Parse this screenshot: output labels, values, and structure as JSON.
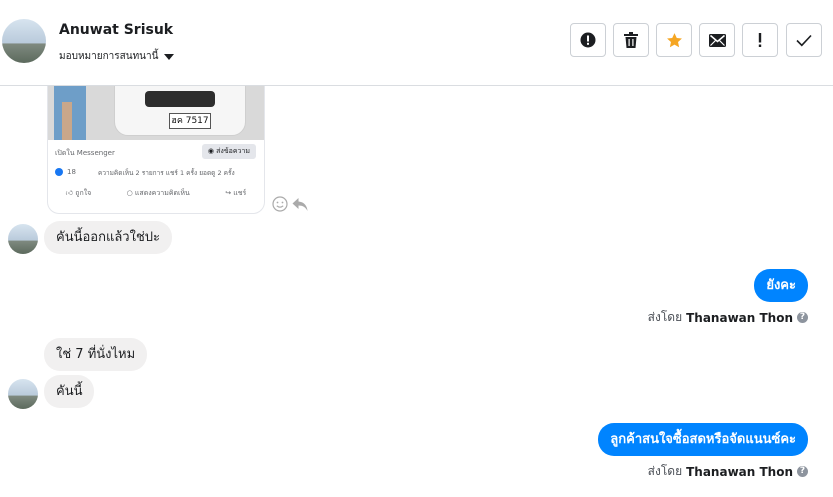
{
  "header": {
    "name": "Anuwat Srisuk",
    "assign_label": "มอบหมายการสนทนานี้",
    "actions": [
      {
        "name": "report-button",
        "icon": "alert-circle-icon"
      },
      {
        "name": "delete-button",
        "icon": "trash-icon"
      },
      {
        "name": "star-button",
        "icon": "star-icon",
        "color": "#f5a623"
      },
      {
        "name": "mark-unread-button",
        "icon": "envelope-icon"
      },
      {
        "name": "important-button",
        "icon": "exclamation-icon"
      },
      {
        "name": "done-button",
        "icon": "check-icon"
      }
    ]
  },
  "shared_post": {
    "plate_text": "ฮค 7517",
    "source_label": "เปิดใน Messenger",
    "send_button": "ส่งข้อความ",
    "like_count": "18",
    "stats": "ความคิดเห็น 2 รายการ  แชร์ 1 ครั้ง  ยอดดู 2 ครั้ง",
    "actions": [
      "ถูกใจ",
      "แสดงความคิดเห็น",
      "แชร์"
    ]
  },
  "messages": [
    {
      "side": "in",
      "text": "คันนี้ออกแล้วใช่ปะ"
    },
    {
      "side": "out",
      "text": "ยังคะ",
      "sent_by_prefix": "ส่งโดย",
      "sent_by_name": "Thanawan Thon"
    },
    {
      "side": "in",
      "text": "ใช่ 7 ที่นั่งไหม"
    },
    {
      "side": "in",
      "text": "คันนี้"
    },
    {
      "side": "out",
      "text": "ลูกค้าสนใจซื้อสดหรือจัดแนนซ์คะ",
      "sent_by_prefix": "ส่งโดย",
      "sent_by_name": "Thanawan Thon"
    }
  ],
  "colors": {
    "accent": "#0084ff",
    "incoming_bubble": "#f1f0f0",
    "star": "#f5a623"
  }
}
